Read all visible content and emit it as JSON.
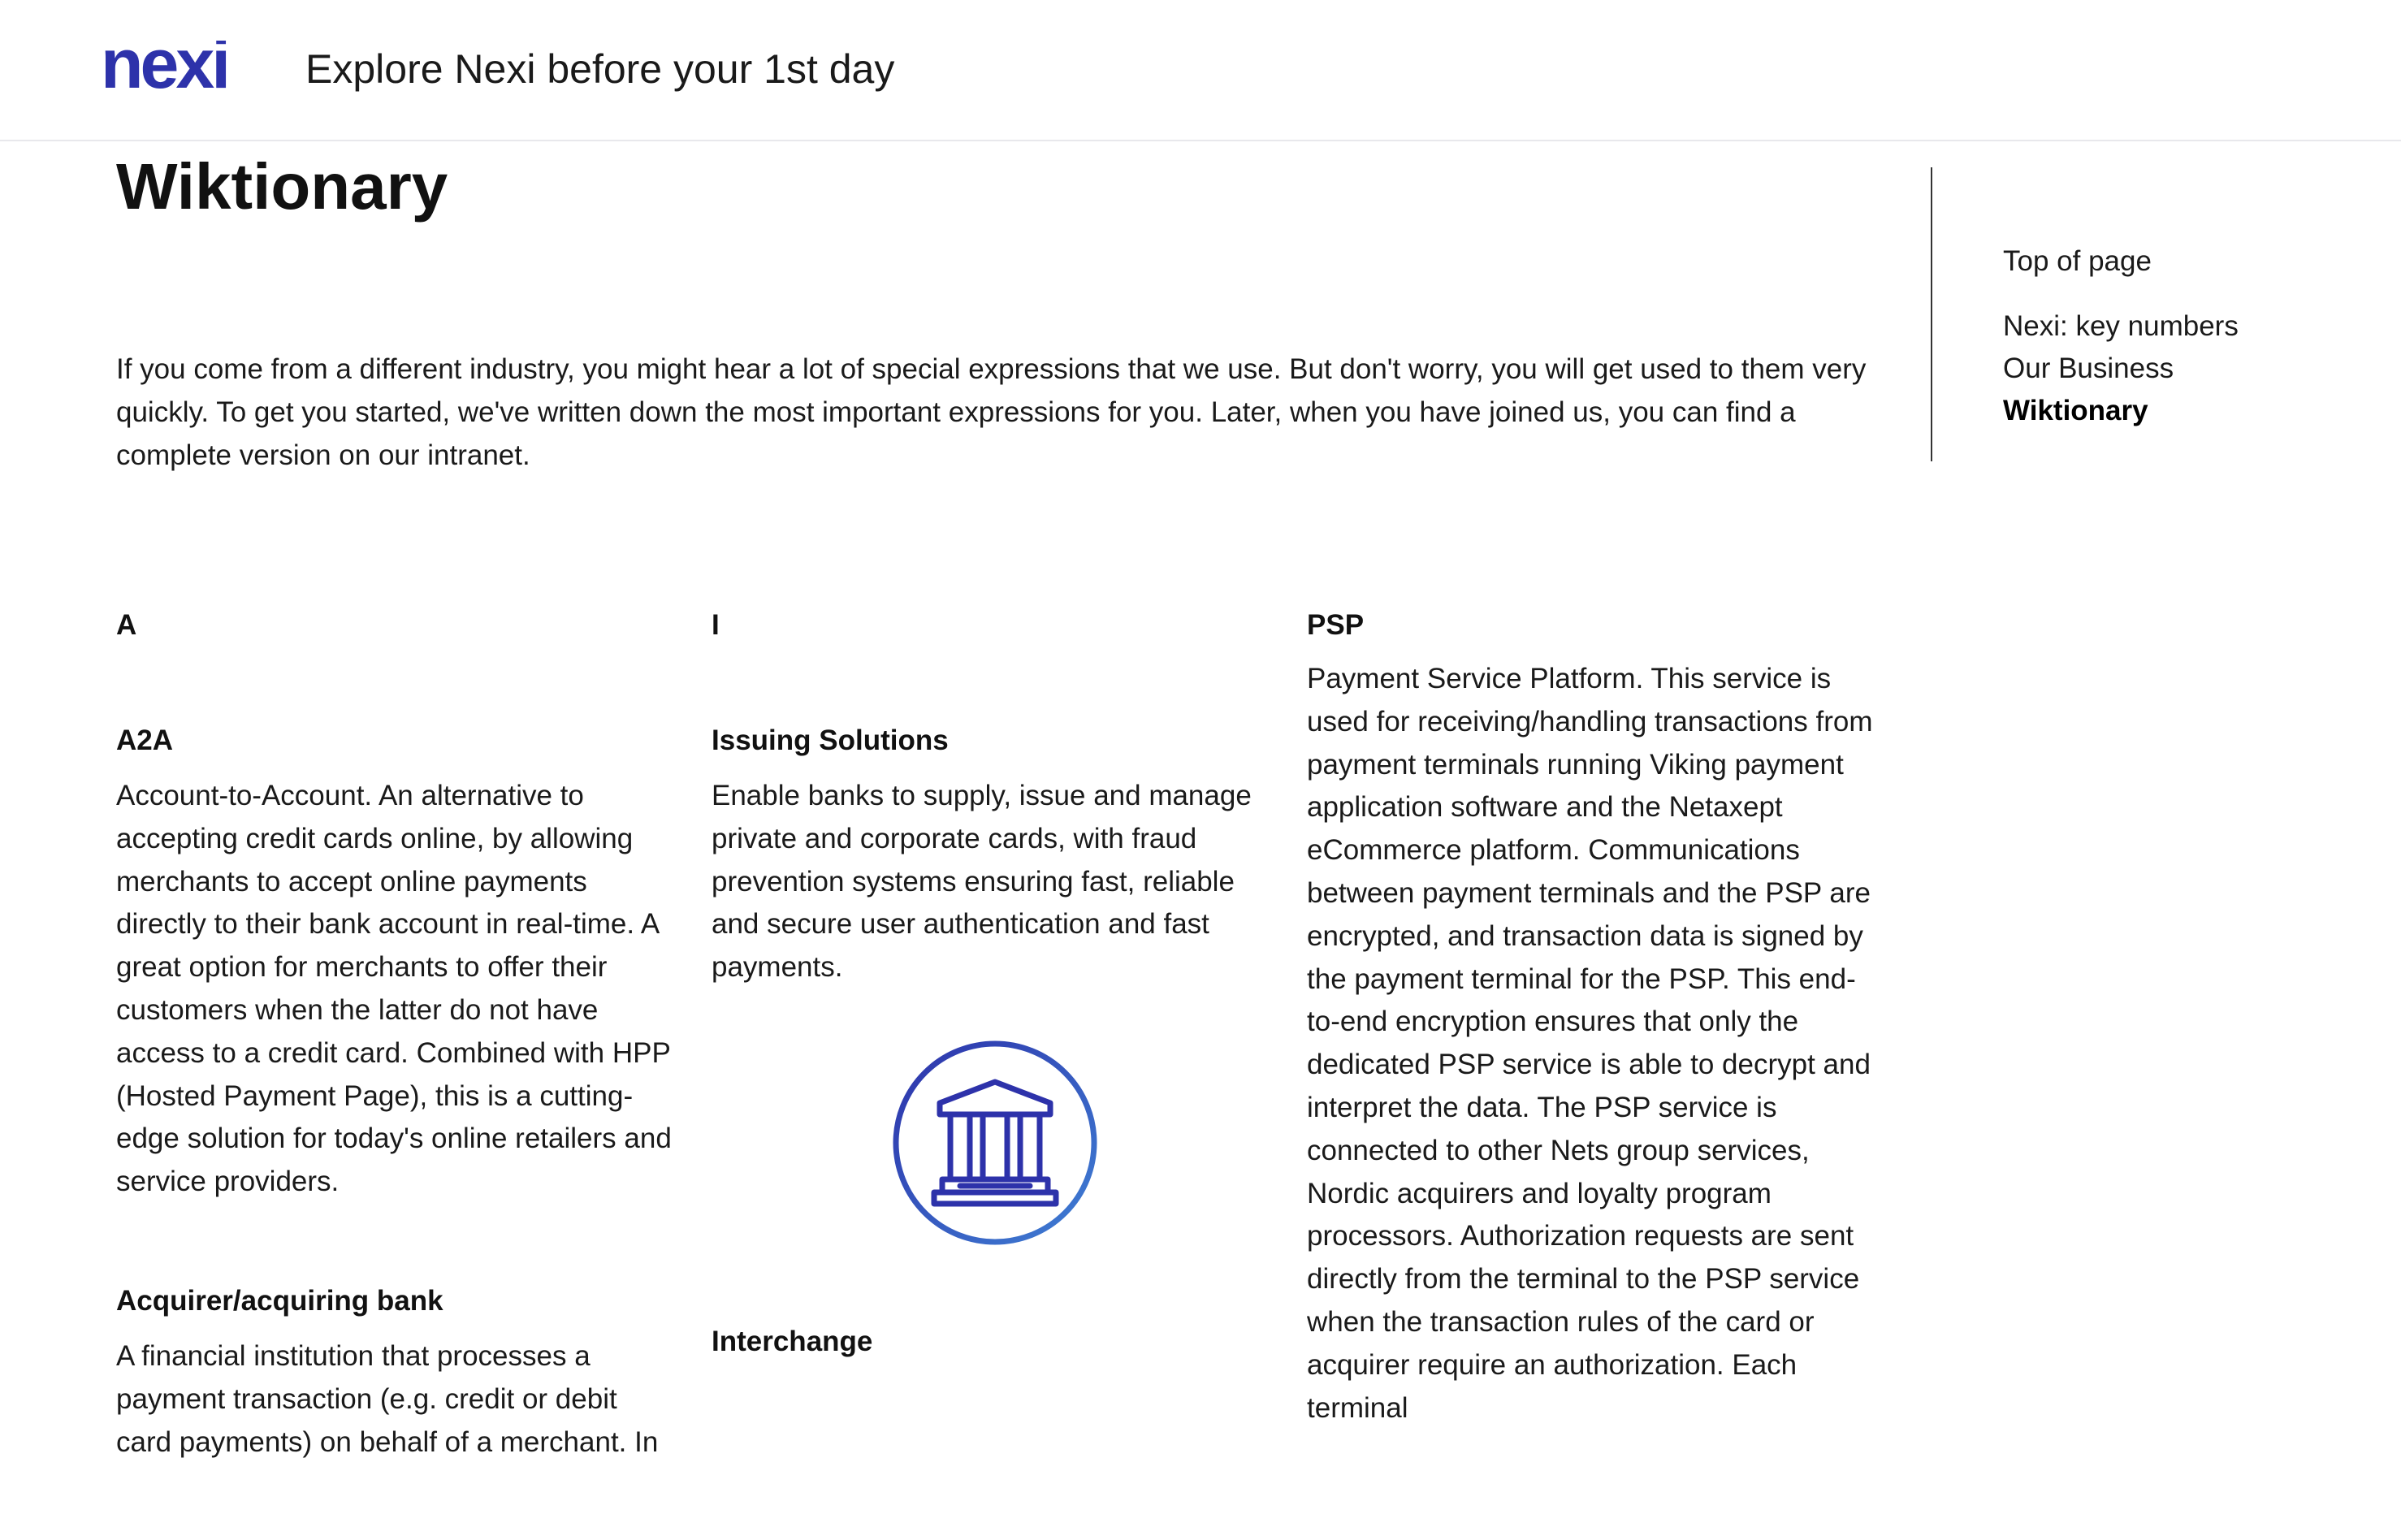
{
  "header": {
    "logo_text": "nexi",
    "site_title": "Explore Nexi before your 1st day"
  },
  "page": {
    "title": "Wiktionary",
    "intro": "If you come from a different industry, you might hear a lot of special expressions that we use. But don't worry, you will get used to them very quickly. To get you started, we've written down the most important expressions for you. Later, when you have joined us, you can find a complete version on our intranet."
  },
  "toc": {
    "top_label": "Top of page",
    "items": [
      {
        "label": "Nexi: key numbers"
      },
      {
        "label": "Our Business"
      },
      {
        "label": "Wiktionary"
      }
    ]
  },
  "glossary": {
    "col_a": {
      "letter": "A",
      "entries": [
        {
          "term": "A2A",
          "definition": "Account-to-Account. An alternative to accepting credit cards online,  by allowing merchants to accept online payments directly to their bank account in real-time. A great option for merchants to offer their customers when the latter do not have access to a credit card. Combined with HPP (Hosted Payment Page), this is a cutting-edge solution for today's online retailers and service providers."
        },
        {
          "term": "Acquirer/acquiring bank",
          "definition": "A financial institution that processes a payment transaction (e.g. credit or debit card payments) on behalf of a merchant. In"
        }
      ]
    },
    "col_i": {
      "letter": "I",
      "entries": [
        {
          "term": "Issuing Solutions",
          "definition": "Enable banks to supply, issue and manage private and corporate cards, with fraud prevention systems ensuring fast, reliable and secure user authentication and fast payments."
        },
        {
          "term": "Interchange",
          "definition": ""
        }
      ],
      "icon": "bank-building-icon"
    },
    "col_p": {
      "entries": [
        {
          "term": "PSP",
          "definition": "Payment Service Platform. This service is used for receiving/handling transactions from payment terminals running Viking  payment application software and the Netaxept eCommerce platform. Communications  between payment  terminals  and  the  PSP  are encrypted, and transaction data is signed by the payment terminal for the PSP.  This end-to-end encryption ensures that only the dedicated PSP service is able to decrypt and interpret the data. The PSP service is connected to other Nets group services, Nordic acquirers and loyalty program processors. Authorization requests are sent directly from the terminal to the PSP  service when the transaction rules of the card or acquirer require an authorization. Each terminal"
        }
      ]
    }
  },
  "colors": {
    "brand": "#2d32aa",
    "brand_gradient_end": "#3f7fd4",
    "text": "#1a1a1a"
  }
}
